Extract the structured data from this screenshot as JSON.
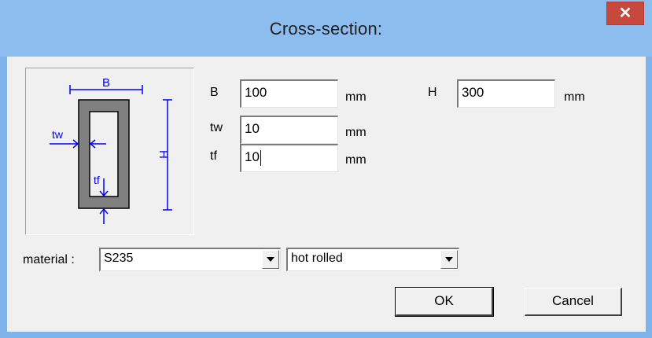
{
  "window": {
    "title": "Cross-section:",
    "close_glyph": "✕"
  },
  "diagram": {
    "label_b": "B",
    "label_h": "H",
    "label_tw": "tw",
    "label_tf": "tf",
    "line_color": "#0000ff",
    "section_color": "#808080"
  },
  "fields": {
    "b": {
      "label": "B",
      "value": "100",
      "unit": "mm"
    },
    "tw": {
      "label": "tw",
      "value": "10",
      "unit": "mm"
    },
    "tf": {
      "label": "tf",
      "value": "10",
      "unit": "mm"
    },
    "h": {
      "label": "H",
      "value": "300",
      "unit": "mm"
    }
  },
  "material": {
    "label": "material :",
    "grade": "S235",
    "process": "hot rolled"
  },
  "buttons": {
    "ok": "OK",
    "cancel": "Cancel"
  }
}
